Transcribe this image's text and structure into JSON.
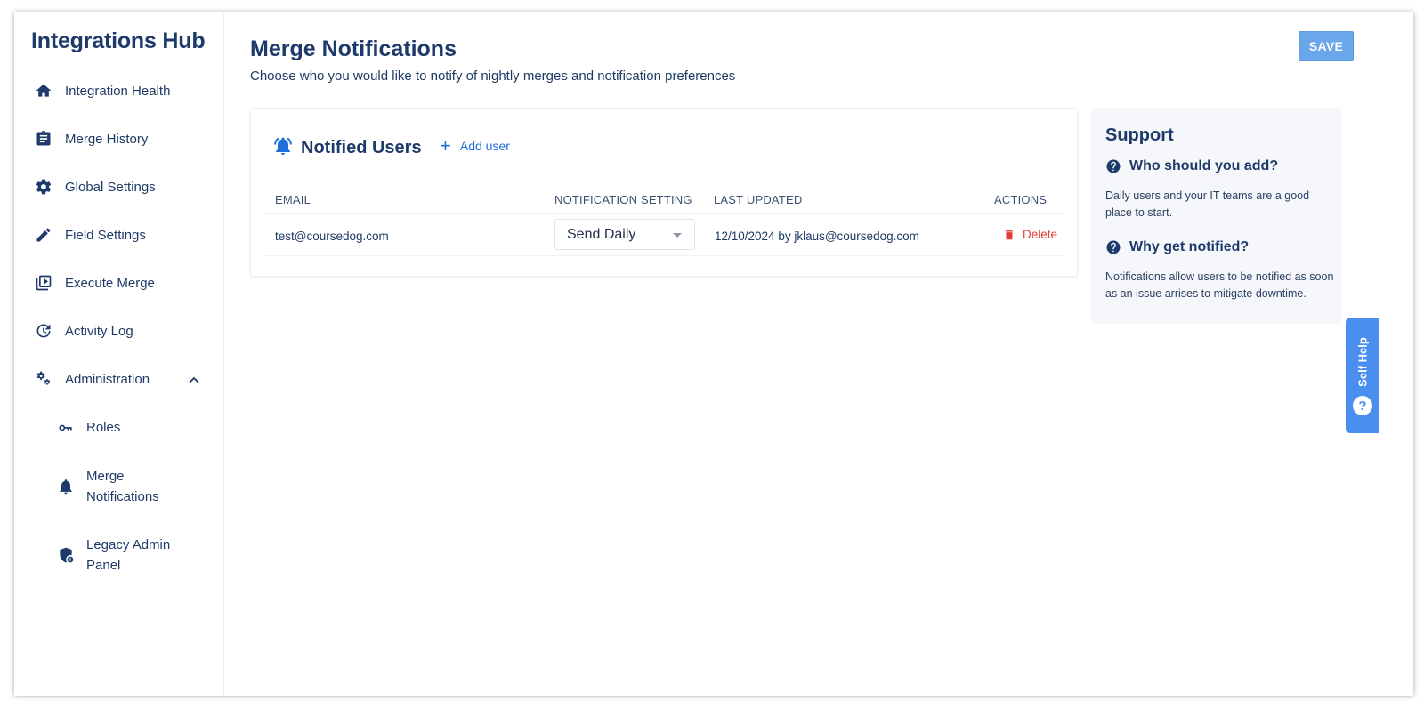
{
  "app": {
    "title": "Integrations Hub"
  },
  "sidebar": {
    "items": [
      {
        "label": "Integration Health",
        "icon": "home-icon"
      },
      {
        "label": "Merge History",
        "icon": "clipboard-icon"
      },
      {
        "label": "Global Settings",
        "icon": "gear-icon"
      },
      {
        "label": "Field Settings",
        "icon": "pencil-icon"
      },
      {
        "label": "Execute Merge",
        "icon": "play-library-icon"
      },
      {
        "label": "Activity Log",
        "icon": "history-icon"
      },
      {
        "label": "Administration",
        "icon": "gears-icon",
        "expanded": true
      }
    ],
    "admin_items": [
      {
        "label": "Roles",
        "icon": "key-icon"
      },
      {
        "label_line1": "Merge",
        "label_line2": "Notifications",
        "icon": "bell-icon",
        "active": true
      },
      {
        "label_line1": "Legacy Admin",
        "label_line2": "Panel",
        "icon": "shield-lock-icon"
      }
    ]
  },
  "header": {
    "title": "Merge Notifications",
    "subtitle": "Choose who you would like to notify of nightly merges and notification preferences",
    "save_label": "SAVE"
  },
  "card": {
    "title": "Notified Users",
    "add_user_label": "Add user",
    "columns": {
      "email": "EMAIL",
      "setting": "NOTIFICATION SETTING",
      "updated": "LAST UPDATED",
      "actions": "ACTIONS"
    },
    "rows": [
      {
        "email": "test@coursedog.com",
        "setting": "Send Daily",
        "updated": "12/10/2024 by jklaus@coursedog.com",
        "action": "Delete"
      }
    ]
  },
  "support": {
    "title": "Support",
    "q1_title": "Who should you add?",
    "q1_body": "Daily users and your IT teams are a good place to start.",
    "q2_title": "Why get notified?",
    "q2_body": "Notifications allow users to be notified as soon as an issue arrises to mitigate downtime."
  },
  "self_help": {
    "label": "Self Help",
    "icon_text": "?"
  },
  "colors": {
    "primary_text": "#1e3a6b",
    "accent_blue": "#1e6fd9",
    "save_button": "#6aa6ea",
    "delete_red": "#e53935",
    "self_help_bg": "#4a8ff0",
    "support_bg": "#f5f7fa"
  }
}
